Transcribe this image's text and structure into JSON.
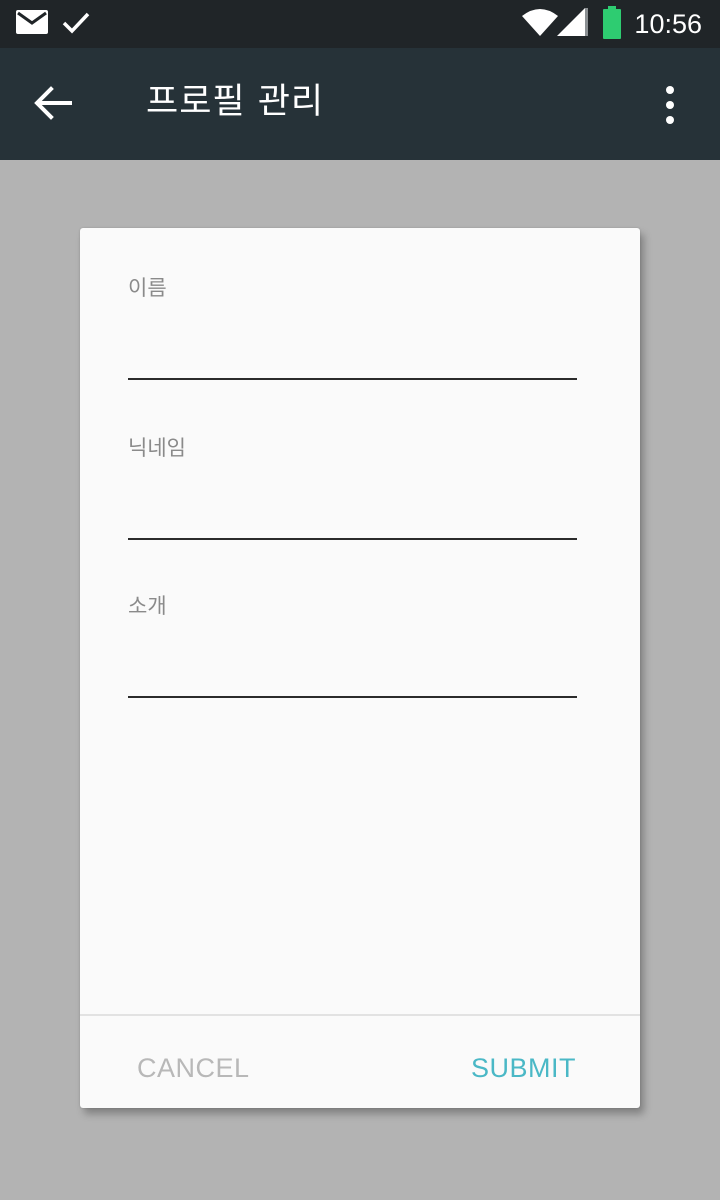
{
  "status_bar": {
    "time": "10:56",
    "icons": [
      "mail-icon",
      "check-icon",
      "wifi-icon",
      "signal-icon",
      "battery-icon"
    ],
    "battery_color": "#2ecc71"
  },
  "app_bar": {
    "title": "프로필 관리",
    "background": "#263238"
  },
  "dialog": {
    "fields": [
      {
        "label": "이름",
        "value": ""
      },
      {
        "label": "닉네임",
        "value": ""
      },
      {
        "label": "소개",
        "value": ""
      }
    ],
    "cancel_label": "CANCEL",
    "submit_label": "SUBMIT",
    "accent_color": "#4ab8c6"
  }
}
